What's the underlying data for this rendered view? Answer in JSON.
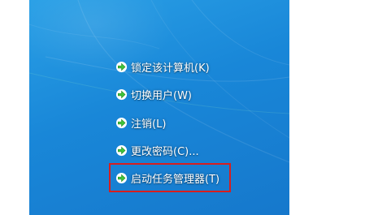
{
  "menu": {
    "items": [
      {
        "label": "锁定该计算机(K)",
        "icon": "green-arrow-icon"
      },
      {
        "label": "切换用户(W)",
        "icon": "green-arrow-icon"
      },
      {
        "label": "注销(L)",
        "icon": "green-arrow-icon"
      },
      {
        "label": "更改密码(C)...",
        "icon": "green-arrow-icon"
      },
      {
        "label": "启动任务管理器(T)",
        "icon": "green-arrow-icon"
      }
    ]
  },
  "colors": {
    "background": "#1987d8",
    "text": "#ffffff",
    "arrow": "#3fc43a",
    "highlight_border": "#d81e1e"
  }
}
